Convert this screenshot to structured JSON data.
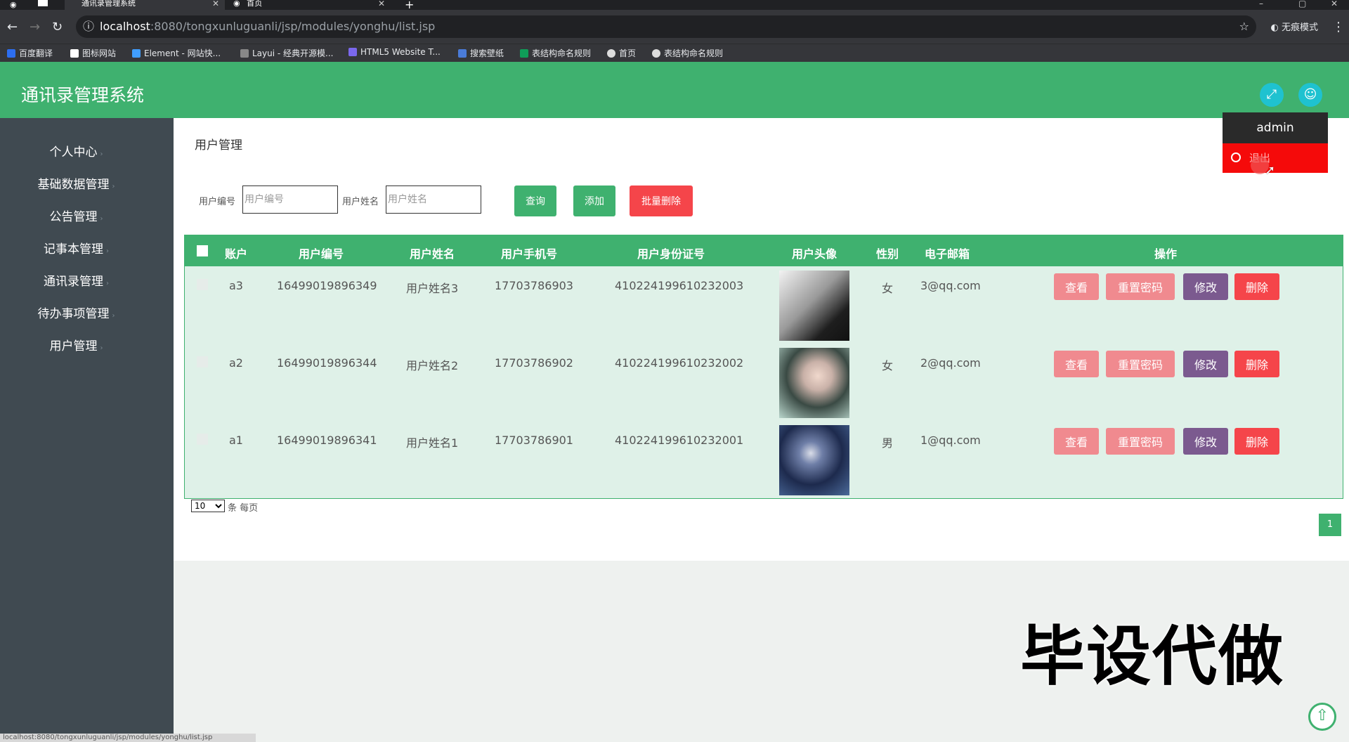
{
  "browser": {
    "tabs": [
      {
        "title": "通讯录管理系统",
        "active": true
      },
      {
        "title": "首页",
        "active": false
      }
    ],
    "url_host": "localhost",
    "url_path": ":8080/tongxunluguanli/jsp/modules/yonghu/list.jsp",
    "incognito_label": "无痕模式",
    "bookmarks": [
      {
        "label": "百度翻译",
        "icon": "translate-icon",
        "color": "#2d6ef0"
      },
      {
        "label": "图标网站",
        "icon": "flag-icon",
        "color": "#ffffff"
      },
      {
        "label": "Element - 网站快...",
        "icon": "element-icon",
        "color": "#409eff"
      },
      {
        "label": "Layui - 经典开源模...",
        "icon": "layui-icon",
        "color": "#888888"
      },
      {
        "label": "HTML5 Website T...",
        "icon": "html5-icon",
        "color": "#7b68ee"
      },
      {
        "label": "搜索壁纸",
        "icon": "wallpaper-icon",
        "color": "#4a7bd8"
      },
      {
        "label": "表结构命名规则",
        "icon": "sheet-icon",
        "color": "#0f9d58"
      },
      {
        "label": "首页",
        "icon": "globe-icon",
        "color": "#dddddd"
      },
      {
        "label": "表结构命名规则",
        "icon": "globe-icon",
        "color": "#dddddd"
      }
    ],
    "status_url": "localhost:8080/tongxunluguanli/jsp/modules/yonghu/list.jsp"
  },
  "header": {
    "title": "通讯录管理系统",
    "accent": "#3fb16f",
    "dropdown": {
      "user": "admin",
      "logout": "退出"
    }
  },
  "sidebar": {
    "items": [
      {
        "label": "个人中心"
      },
      {
        "label": "基础数据管理"
      },
      {
        "label": "公告管理"
      },
      {
        "label": "记事本管理"
      },
      {
        "label": "通讯录管理"
      },
      {
        "label": "待办事项管理"
      },
      {
        "label": "用户管理"
      }
    ]
  },
  "main": {
    "heading": "用户管理",
    "search": {
      "code_label": "用户编号",
      "code_placeholder": "用户编号",
      "name_label": "用户姓名",
      "name_placeholder": "用户姓名",
      "query_btn": "查询",
      "add_btn": "添加",
      "batch_delete_btn": "批量删除"
    },
    "table": {
      "headers": [
        "账户",
        "用户编号",
        "用户姓名",
        "用户手机号",
        "用户身份证号",
        "用户头像",
        "性别",
        "电子邮箱",
        "操作"
      ],
      "rows": [
        {
          "account": "a3",
          "code": "16499019896349",
          "name": "用户姓名3",
          "phone": "17703786903",
          "idcard": "410224199610232003",
          "gender": "女",
          "email": "3@qq.com"
        },
        {
          "account": "a2",
          "code": "16499019896344",
          "name": "用户姓名2",
          "phone": "17703786902",
          "idcard": "410224199610232002",
          "gender": "女",
          "email": "2@qq.com"
        },
        {
          "account": "a1",
          "code": "16499019896341",
          "name": "用户姓名1",
          "phone": "17703786901",
          "idcard": "410224199610232001",
          "gender": "男",
          "email": "1@qq.com"
        }
      ],
      "actions": {
        "view": "查看",
        "reset": "重置密码",
        "edit": "修改",
        "delete": "删除"
      }
    },
    "pager": {
      "page_size": "10",
      "per_page_text": "条 每页",
      "current_page": "1"
    }
  },
  "overlay": {
    "watermark": "毕设代做"
  }
}
